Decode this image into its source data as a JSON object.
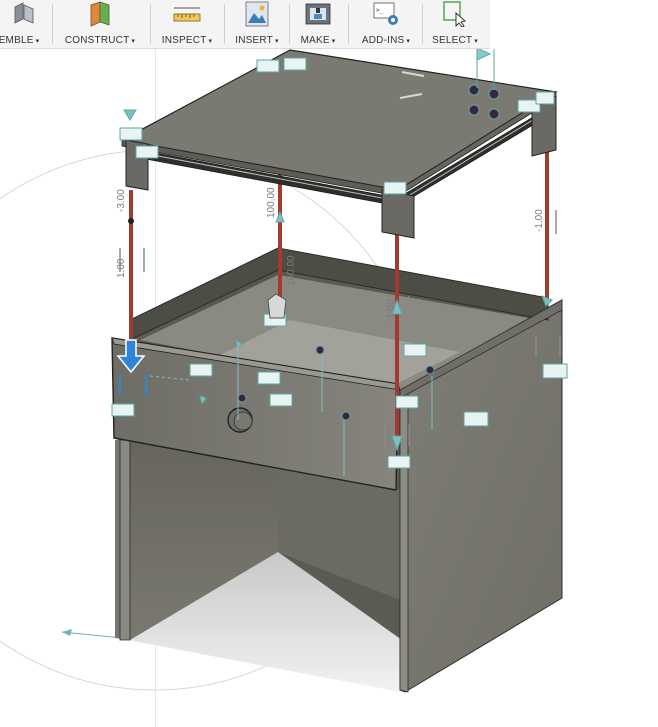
{
  "toolbar": {
    "groups": [
      {
        "label": "EMBLE",
        "icon": "assemble-icon"
      },
      {
        "label": "CONSTRUCT",
        "icon": "construct-plane-icon"
      },
      {
        "label": "INSPECT",
        "icon": "measure-ruler-icon"
      },
      {
        "label": "INSERT",
        "icon": "insert-image-icon"
      },
      {
        "label": "MAKE",
        "icon": "3d-print-icon"
      },
      {
        "label": "ADD-INS",
        "icon": "scripts-addins-icon"
      },
      {
        "label": "SELECT",
        "icon": "select-cursor-icon"
      }
    ],
    "caret": "▾"
  },
  "dimensions": {
    "left_post": "-3.00",
    "left_spacer": "1.00",
    "center_height": "100.00",
    "center_lower": "100.00",
    "front_post": "-1.00",
    "right_post": "-1.00"
  }
}
